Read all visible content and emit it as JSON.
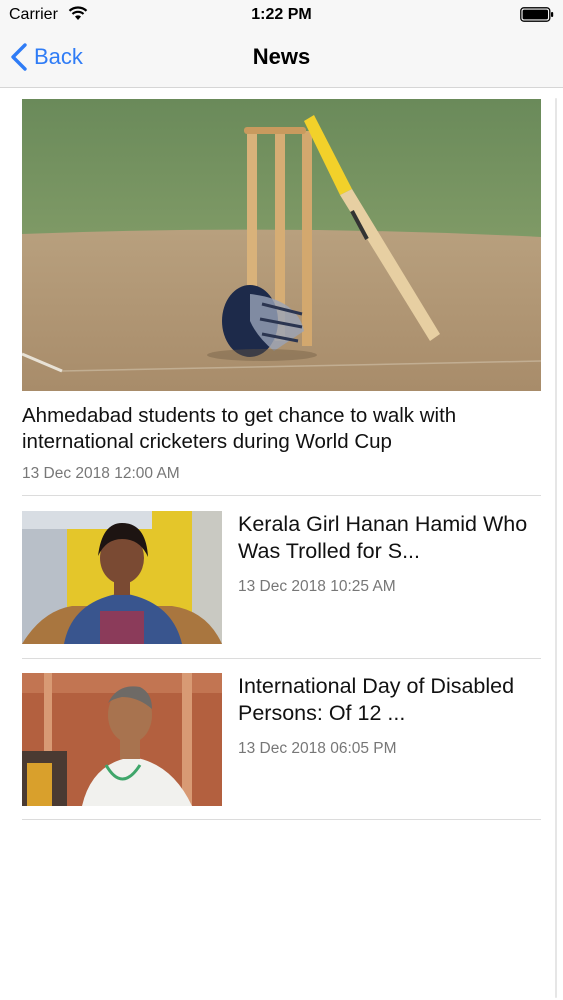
{
  "status_bar": {
    "carrier": "Carrier",
    "time": "1:22 PM",
    "icons": [
      "wifi-icon",
      "battery-icon"
    ]
  },
  "nav": {
    "back_label": "Back",
    "title": "News",
    "accent_color": "#2f7cf6"
  },
  "featured": {
    "title": "Ahmedabad students to get chance to walk with international cricketers during World Cup",
    "date": "13 Dec 2018 12:00 AM"
  },
  "articles": [
    {
      "title": "Kerala Girl Hanan Hamid Who Was Trolled for S...",
      "date": "13 Dec 2018 10:25 AM"
    },
    {
      "title": "International Day of Disabled Persons: Of 12 ...",
      "date": "13 Dec 2018 06:05 PM"
    }
  ]
}
